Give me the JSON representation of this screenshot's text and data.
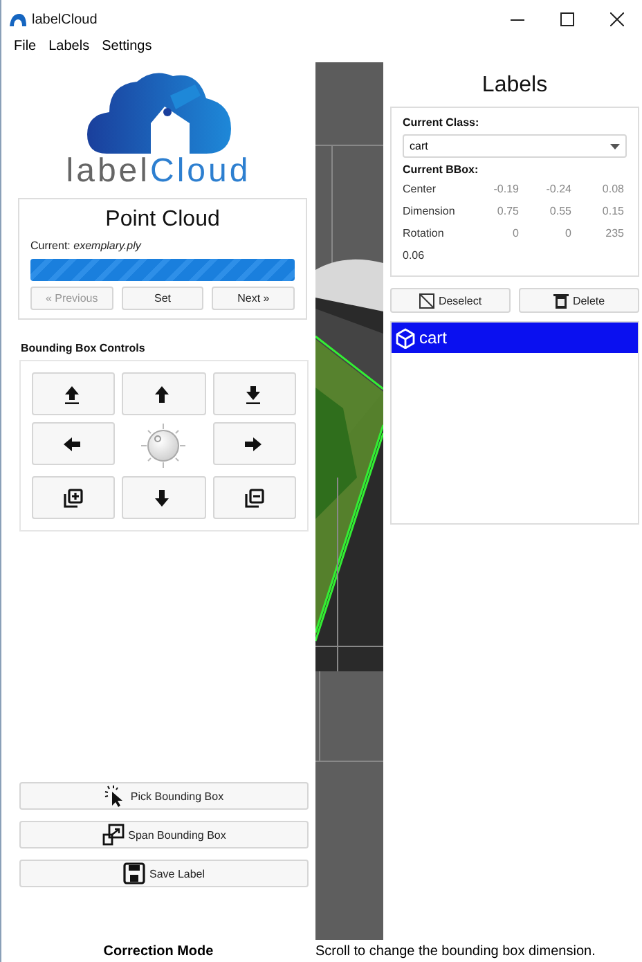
{
  "window": {
    "title": "labelCloud"
  },
  "menu": [
    "File",
    "Labels",
    "Settings"
  ],
  "logo": {
    "parts": [
      "label",
      "Cloud"
    ]
  },
  "point_cloud": {
    "title": "Point Cloud",
    "current": "Current: *exemplary.ply*",
    "progress": {
      "level": 1
    },
    "buttons": [
      {
        "label": "« Previous",
        "disabled": true
      },
      {
        "label": "Set",
        "disabled": false
      },
      {
        "label": "Next »",
        "disabled": false
      }
    ]
  },
  "bbox_controls": {
    "title": "Bounding Box Controls",
    "items": [
      {
        "kind": "button"
      },
      {
        "kind": "button"
      },
      {
        "kind": "button"
      },
      {
        "kind": "button"
      },
      {
        "kind": "dial"
      },
      {
        "kind": "button"
      },
      {
        "kind": "button"
      },
      {
        "kind": "button"
      },
      {
        "kind": "button"
      }
    ]
  },
  "actions": [
    {
      "label": "Pick Bounding Box"
    },
    {
      "label": "Span Bounding Box"
    },
    {
      "label": "Save Label"
    }
  ],
  "labels": {
    "title": "Labels",
    "class_heading": "Current Class:",
    "class_value": "cart",
    "bbox_heading": "Current BBox:",
    "rows": [
      {
        "name": "Center",
        "values": [
          "-0.19",
          "-0.24",
          "0.08"
        ]
      },
      {
        "name": "Dimension",
        "values": [
          "0.75",
          "0.55",
          "0.15"
        ]
      },
      {
        "name": "Rotation",
        "values": [
          "0",
          "0",
          "235"
        ]
      }
    ],
    "volume": "0.06",
    "buttons": [
      {
        "label": "Deselect"
      },
      {
        "label": "Delete"
      }
    ],
    "list": [
      {
        "name": "cart",
        "selected": true
      }
    ]
  },
  "status_bar": {
    "mode": "Correction Mode",
    "hint": "Scroll to change the bounding box dimension."
  }
}
